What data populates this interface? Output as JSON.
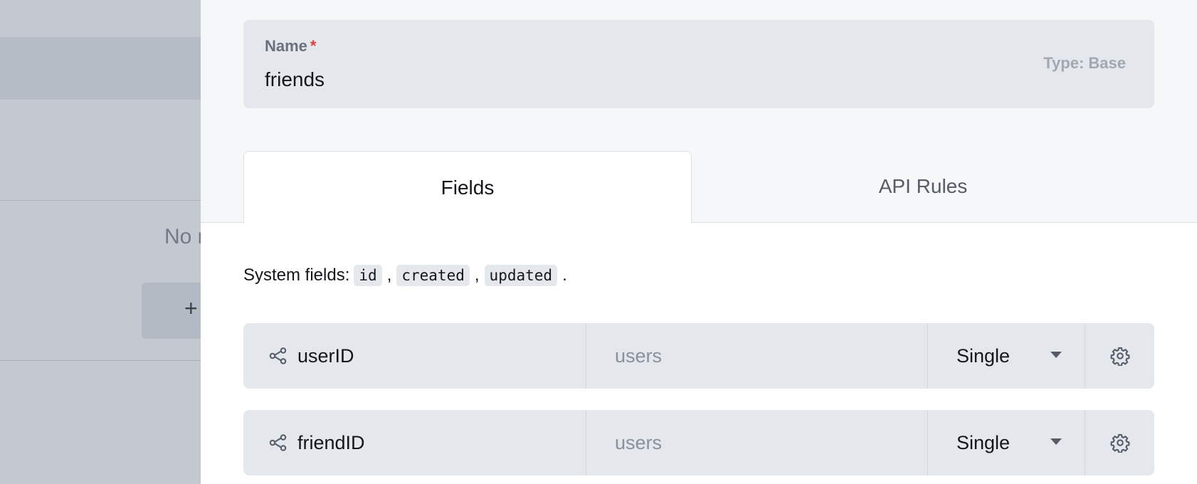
{
  "background": {
    "empty_text": "No r",
    "new_button_label": "+"
  },
  "form": {
    "name_label": "Name",
    "required_mark": "*",
    "name_value": "friends",
    "type_label": "Type: Base"
  },
  "tabs": [
    {
      "label": "Fields",
      "active": true
    },
    {
      "label": "API Rules",
      "active": false
    }
  ],
  "system_fields": {
    "prefix": "System fields:",
    "items": [
      "id",
      "created",
      "updated"
    ],
    "separator": ",",
    "suffix": "."
  },
  "fields": [
    {
      "name": "userID",
      "collection": "users",
      "type": "Single",
      "icon": "relation-icon"
    },
    {
      "name": "friendID",
      "collection": "users",
      "type": "Single",
      "icon": "relation-icon"
    }
  ],
  "colors": {
    "required": "#e0413e",
    "panel_bg": "#f6f7f9",
    "field_bg": "#e4e7eb"
  }
}
